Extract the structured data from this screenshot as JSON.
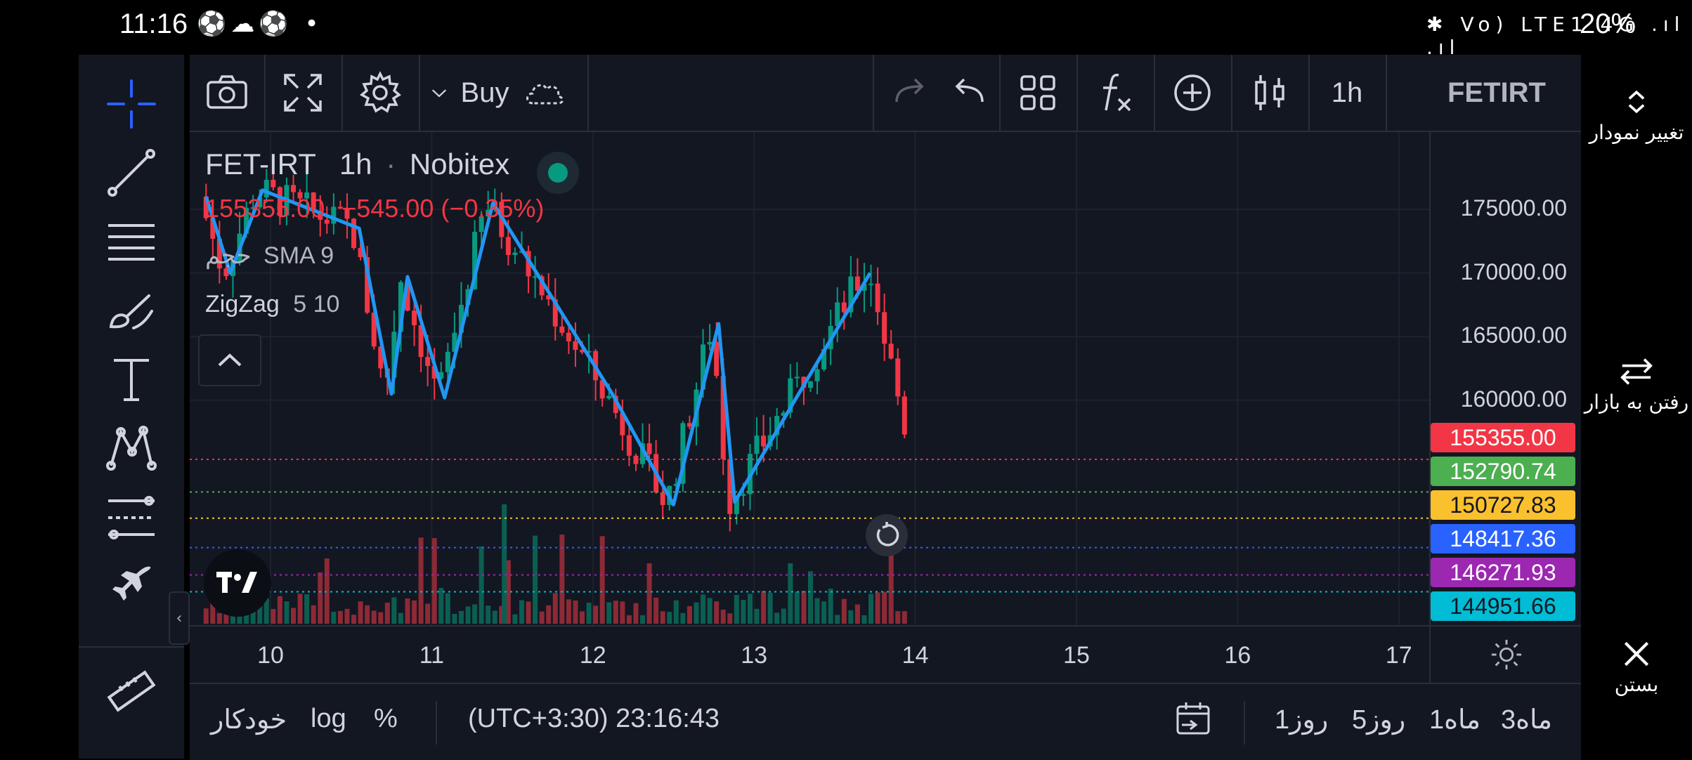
{
  "status_bar": {
    "time": "11:16",
    "left_icons": "⚽☁⚽ •",
    "right_icons": "✱ Vo) LTE1 4G .ıl .ıl",
    "battery": "20%"
  },
  "toolbar": {
    "buy_label": "Buy",
    "interval": "1h",
    "symbol": "FETIRT"
  },
  "legend": {
    "symbol": "FET-IRT",
    "interval": "1h",
    "exchange": "Nobitex",
    "last_price": "155355.00",
    "change": "−545.00 (−0.35%)",
    "sma_name": "حجم",
    "sma_label": "SMA 9",
    "zigzag_name": "ZigZag",
    "zigzag_params": "5 10"
  },
  "colors": {
    "up": "#089981",
    "down": "#f23645",
    "zigzag": "#2196f3",
    "background": "#131722"
  },
  "chart_data": {
    "type": "candlestick",
    "symbol": "FET-IRT",
    "interval": "1h",
    "x_ticks": [
      "10",
      "11",
      "12",
      "13",
      "14",
      "15",
      "16",
      "17"
    ],
    "y_ticks": [
      "175000.00",
      "170000.00",
      "165000.00",
      "160000.00"
    ],
    "ylim": [
      141500,
      176500
    ],
    "zigzag": [
      {
        "day": 9.6,
        "price": 176000
      },
      {
        "day": 9.75,
        "price": 170000
      },
      {
        "day": 9.95,
        "price": 176500
      },
      {
        "day": 10.55,
        "price": 173500
      },
      {
        "day": 10.75,
        "price": 160500
      },
      {
        "day": 10.85,
        "price": 169700
      },
      {
        "day": 11.08,
        "price": 160200
      },
      {
        "day": 11.38,
        "price": 175500
      },
      {
        "day": 12.12,
        "price": 160500
      },
      {
        "day": 12.5,
        "price": 151800
      },
      {
        "day": 12.78,
        "price": 166000
      },
      {
        "day": 12.88,
        "price": 152000
      },
      {
        "day": 13.72,
        "price": 170000
      }
    ],
    "price_lines": [
      {
        "value": 155355.0,
        "label": "155355.00",
        "color": "#f23645",
        "text": "#ffffff"
      },
      {
        "value": 152790.74,
        "label": "152790.74",
        "color": "#4caf50",
        "text": "#ffffff"
      },
      {
        "value": 150727.83,
        "label": "150727.83",
        "color": "#fbc02d",
        "text": "#131722"
      },
      {
        "value": 148417.36,
        "label": "148417.36",
        "color": "#2962ff",
        "text": "#ffffff"
      },
      {
        "value": 146271.93,
        "label": "146271.93",
        "color": "#9c27b0",
        "text": "#ffffff"
      },
      {
        "value": 144951.66,
        "label": "144951.66",
        "color": "#00bcd4",
        "text": "#131722"
      }
    ]
  },
  "bottom_bar": {
    "range_3m": "3ماه",
    "range_1m": "1ماه",
    "range_5d": "5روز",
    "range_1d": "1روز",
    "timezone": "(UTC+3:30) 23:16:43",
    "percent": "%",
    "log": "log",
    "auto": "خودکار"
  },
  "right_panel": {
    "change_chart": "تغییر نمودار",
    "go_market": "رفتن به بازار",
    "close": "بستن"
  }
}
